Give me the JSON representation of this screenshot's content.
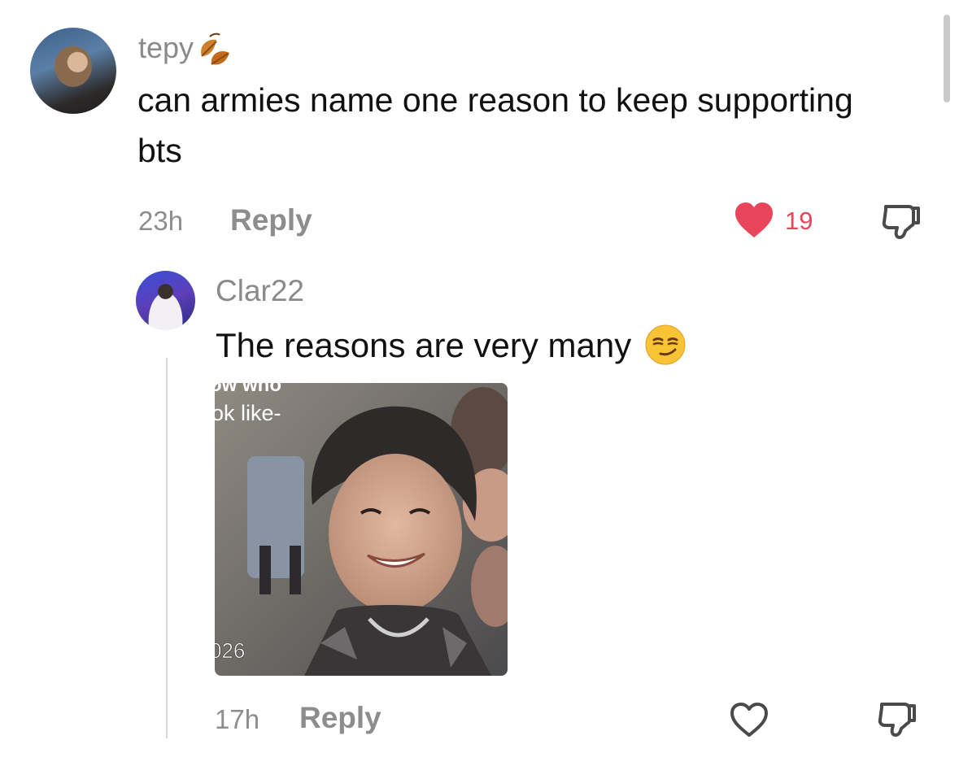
{
  "comment": {
    "username": "tepy",
    "text": "can armies name one reason to keep supporting bts",
    "time": "23h",
    "reply_label": "Reply",
    "like_count": "19",
    "liked": true
  },
  "reply": {
    "username": "Clar22",
    "text": "The reasons are very many",
    "image_caption_lines": [
      "ow who",
      "ok like-"
    ],
    "image_corner_text": "026",
    "time": "17h",
    "reply_label": "Reply",
    "liked": false
  },
  "colors": {
    "like_active": "#e8445a",
    "meta_gray": "#8d8d8d"
  },
  "icons": [
    "heart-filled-icon",
    "dislike-icon",
    "heart-outline-icon",
    "leaf-emoji-icon",
    "smirk-emoji-icon"
  ]
}
